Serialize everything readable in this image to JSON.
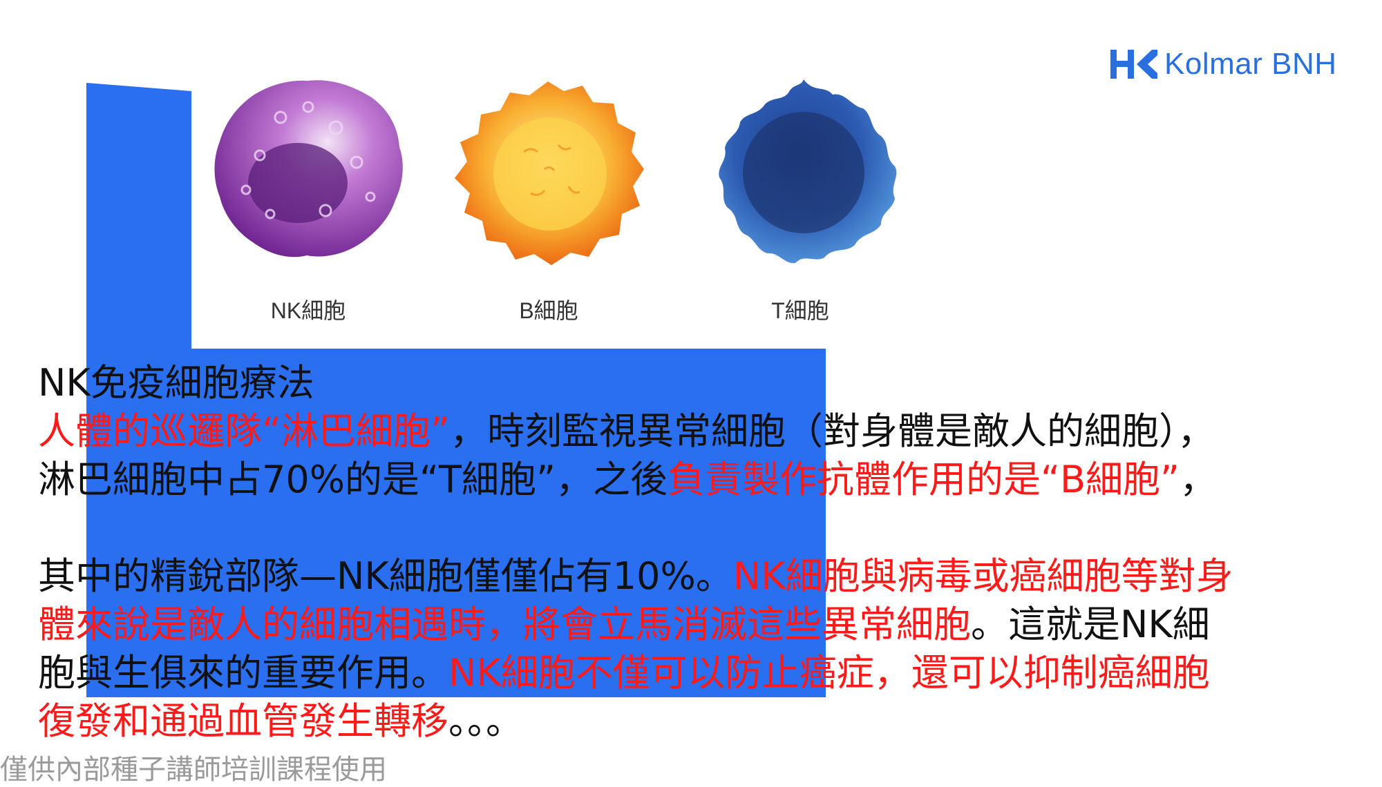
{
  "brand": {
    "logo_text": "Kolmar BNH",
    "color": "#2a6fe0"
  },
  "cells": [
    {
      "label": "NK細胞",
      "icon": "nk-cell-illustration",
      "color": "#8e3fb3"
    },
    {
      "label": "B細胞",
      "icon": "b-cell-illustration",
      "color": "#f47a12"
    },
    {
      "label": "T細胞",
      "icon": "t-cell-illustration",
      "color": "#2f64b8"
    }
  ],
  "content": {
    "title": "NK免疫細胞療法",
    "p1_line1_red": "人體的巡邏隊“淋巴細胞”",
    "p1_line1_black": "，時刻監視異常細胞（對身體是敵人的細胞），",
    "p1_line2_black": "淋巴細胞中占70%的是“T細胞”，之後",
    "p1_line2_red": "負責製作抗體作用的是“B細胞”",
    "p1_line2_end": "，",
    "p2_line1_black": "其中的精銳部隊—NK細胞僅僅佔有10%。",
    "p2_line1_red": "NK細胞與病毒或癌細胞等對身",
    "p2_line2_red": "體來說是敵人的細胞相遇時，將會立馬消滅這些異常細胞",
    "p2_line2_black": "。這就是NK細",
    "p2_line3_black": "胞與生俱來的重要作用。",
    "p2_line3_red": "NK細胞不僅可以防止癌症，還可以抑制癌細胞",
    "p2_line4_red": "復發和通過血管發生轉移",
    "p2_line4_black": "。。。"
  },
  "footer": {
    "note": "僅供內部種子講師培訓課程使用"
  },
  "colors": {
    "accent_blue": "#2a6ff0",
    "highlight_red": "#ff1a1a"
  }
}
